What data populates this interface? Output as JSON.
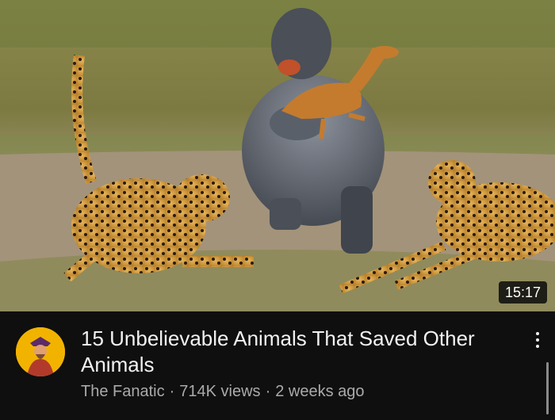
{
  "video": {
    "duration": "15:17",
    "title": "15 Unbelievable Animals That Saved Other Animals",
    "channel": "The Fanatic",
    "views": "714K views",
    "age": "2 weeks ago",
    "separator": "·"
  },
  "icons": {
    "more": "more-vertical-icon",
    "avatar": "channel-avatar"
  },
  "colors": {
    "background": "#0f0f0f",
    "title": "#f1f1f1",
    "meta": "#aaaaaa",
    "avatar_bg": "#f2b300"
  }
}
